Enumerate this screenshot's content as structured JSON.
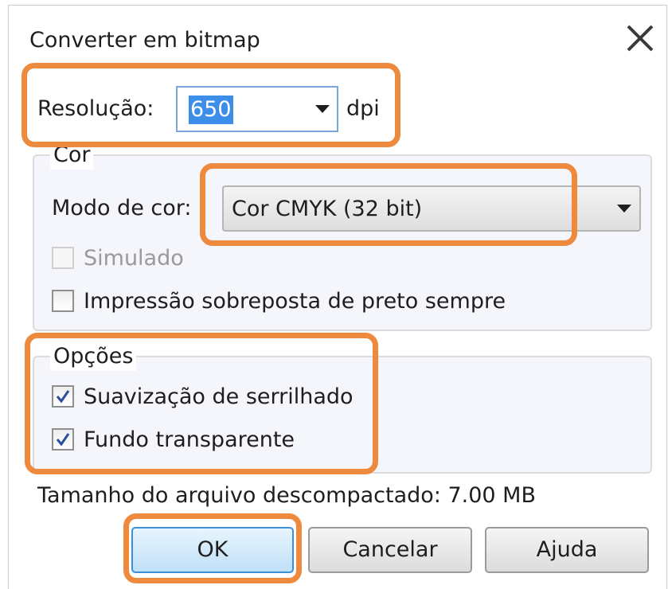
{
  "dialog": {
    "title": "Converter em bitmap"
  },
  "resolution": {
    "label": "Resolução:",
    "value": "650",
    "unit": "dpi"
  },
  "color_group": {
    "title": "Cor",
    "mode_label": "Modo de cor:",
    "mode_value": "Cor CMYK (32 bit)",
    "simulated": {
      "label": "Simulado",
      "checked": false,
      "enabled": false
    },
    "overprint": {
      "label": "Impressão sobreposta de preto sempre",
      "checked": false,
      "enabled": true
    }
  },
  "options_group": {
    "title": "Opções",
    "antialiasing": {
      "label": "Suavização de serrilhado",
      "checked": true
    },
    "transparent_background": {
      "label": "Fundo transparente",
      "checked": true
    }
  },
  "file_size": {
    "text": "Tamanho do arquivo descompactado: 7.00 MB"
  },
  "buttons": {
    "ok": "OK",
    "cancel": "Cancelar",
    "help": "Ajuda"
  },
  "colors": {
    "highlight": "#ee8a3e",
    "selection": "#3d8ee8",
    "checkmark": "#2a4f9a"
  },
  "icons": {
    "close": "close-icon",
    "dropdown": "chevron-down-icon",
    "check": "checkmark-icon"
  }
}
